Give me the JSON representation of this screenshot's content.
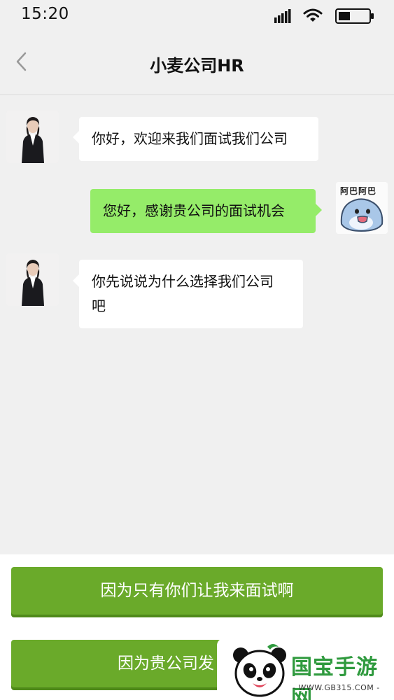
{
  "status_bar": {
    "time": "15:20",
    "icons": [
      "signal-icon",
      "wifi-icon",
      "battery-icon"
    ]
  },
  "header": {
    "title": "小麦公司HR",
    "back_icon": "chevron-left-icon"
  },
  "messages": [
    {
      "sender": "hr",
      "text": "你好，欢迎来我们面试我们公司"
    },
    {
      "sender": "me",
      "text": "您好，感谢贵公司的面试机会"
    },
    {
      "sender": "hr",
      "text_lines": [
        "你先说说为什么选择我们公司",
        "吧"
      ]
    }
  ],
  "me_avatar": {
    "sticker_text": "阿巴阿巴"
  },
  "options": [
    {
      "label": "因为只有你们让我来面试啊"
    },
    {
      "label": "因为贵公司发"
    }
  ],
  "watermark": {
    "title": "国宝手游网",
    "url": "- WWW.GB315.COM -"
  },
  "colors": {
    "background": "#f0f0f0",
    "bubble_self": "#95ec69",
    "bubble_other": "#ffffff",
    "option_button": "#6aaa2a",
    "watermark_green": "#2f9a3e"
  }
}
